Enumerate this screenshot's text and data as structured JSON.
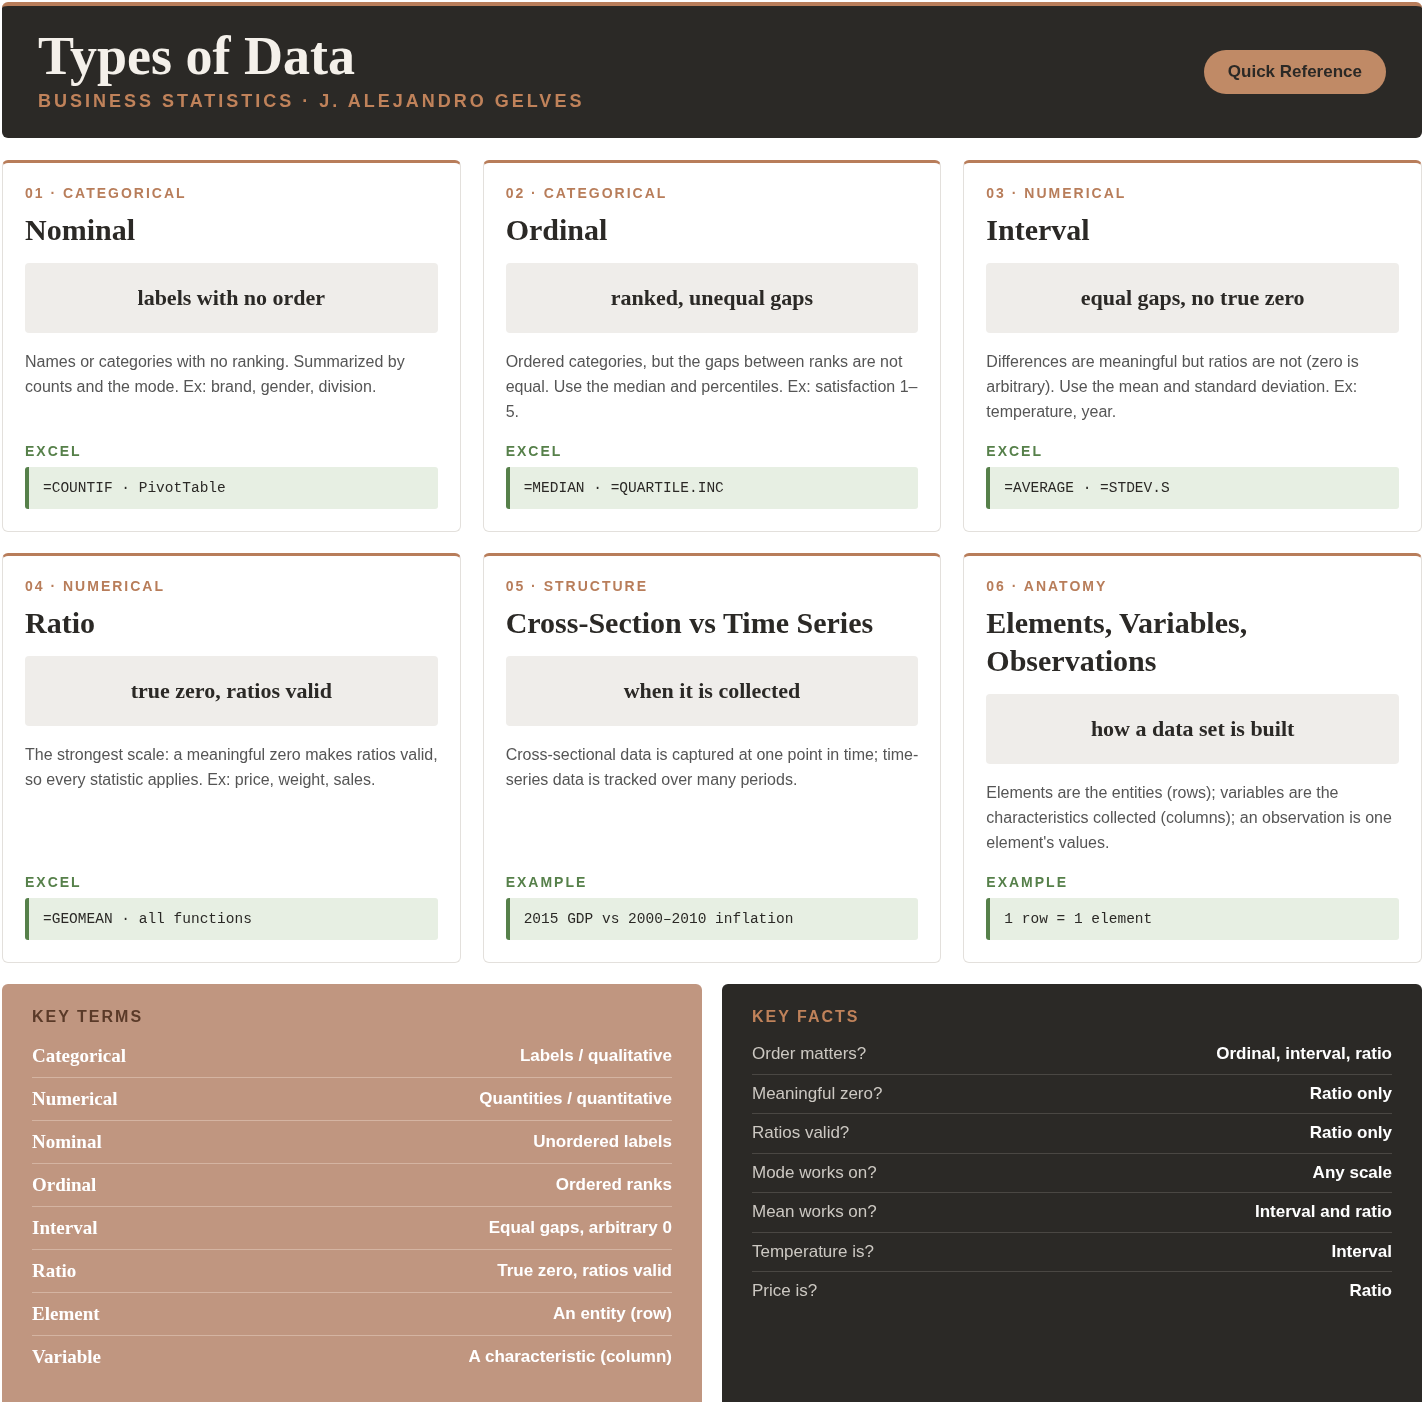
{
  "header": {
    "title": "Types of Data",
    "subtitle": "BUSINESS STATISTICS · J. ALEJANDRO GELVES",
    "button": "Quick Reference"
  },
  "cards": [
    {
      "tag": "01 · CATEGORICAL",
      "title": "Nominal",
      "summary": "labels with no order",
      "description": "Names or categories with no ranking. Summarized by counts and the mode. Ex: brand, gender, division.",
      "code_label": "EXCEL",
      "code": "=COUNTIF · PivotTable"
    },
    {
      "tag": "02 · CATEGORICAL",
      "title": "Ordinal",
      "summary": "ranked, unequal gaps",
      "description": "Ordered categories, but the gaps between ranks are not equal. Use the median and percentiles. Ex: satisfaction 1–5.",
      "code_label": "EXCEL",
      "code": "=MEDIAN · =QUARTILE.INC"
    },
    {
      "tag": "03 · NUMERICAL",
      "title": "Interval",
      "summary": "equal gaps, no true zero",
      "description": "Differences are meaningful but ratios are not (zero is arbitrary). Use the mean and standard deviation. Ex: temperature, year.",
      "code_label": "EXCEL",
      "code": "=AVERAGE · =STDEV.S"
    },
    {
      "tag": "04 · NUMERICAL",
      "title": "Ratio",
      "summary": "true zero, ratios valid",
      "description": "The strongest scale: a meaningful zero makes ratios valid, so every statistic applies. Ex: price, weight, sales.",
      "code_label": "EXCEL",
      "code": "=GEOMEAN · all functions"
    },
    {
      "tag": "05 · STRUCTURE",
      "title": "Cross-Section vs Time Series",
      "summary": "when it is collected",
      "description": "Cross-sectional data is captured at one point in time; time-series data is tracked over many periods.",
      "code_label": "EXAMPLE",
      "code": "2015 GDP vs 2000–2010 inflation"
    },
    {
      "tag": "06 · ANATOMY",
      "title": "Elements, Variables, Observations",
      "summary": "how a data set is built",
      "description": "Elements are the entities (rows); variables are the characteristics collected (columns); an observation is one element's values.",
      "code_label": "EXAMPLE",
      "code": "1 row = 1 element"
    }
  ],
  "key_terms": {
    "title": "KEY TERMS",
    "rows": [
      {
        "term": "Categorical",
        "definition": "Labels / qualitative"
      },
      {
        "term": "Numerical",
        "definition": "Quantities / quantitative"
      },
      {
        "term": "Nominal",
        "definition": "Unordered labels"
      },
      {
        "term": "Ordinal",
        "definition": "Ordered ranks"
      },
      {
        "term": "Interval",
        "definition": "Equal gaps, arbitrary 0"
      },
      {
        "term": "Ratio",
        "definition": "True zero, ratios valid"
      },
      {
        "term": "Element",
        "definition": "An entity (row)"
      },
      {
        "term": "Variable",
        "definition": "A characteristic (column)"
      }
    ]
  },
  "key_facts": {
    "title": "KEY FACTS",
    "rows": [
      {
        "question": "Order matters?",
        "answer": "Ordinal, interval, ratio"
      },
      {
        "question": "Meaningful zero?",
        "answer": "Ratio only"
      },
      {
        "question": "Ratios valid?",
        "answer": "Ratio only"
      },
      {
        "question": "Mode works on?",
        "answer": "Any scale"
      },
      {
        "question": "Mean works on?",
        "answer": "Interval and ratio"
      },
      {
        "question": "Temperature is?",
        "answer": "Interval"
      },
      {
        "question": "Price is?",
        "answer": "Ratio"
      }
    ]
  }
}
